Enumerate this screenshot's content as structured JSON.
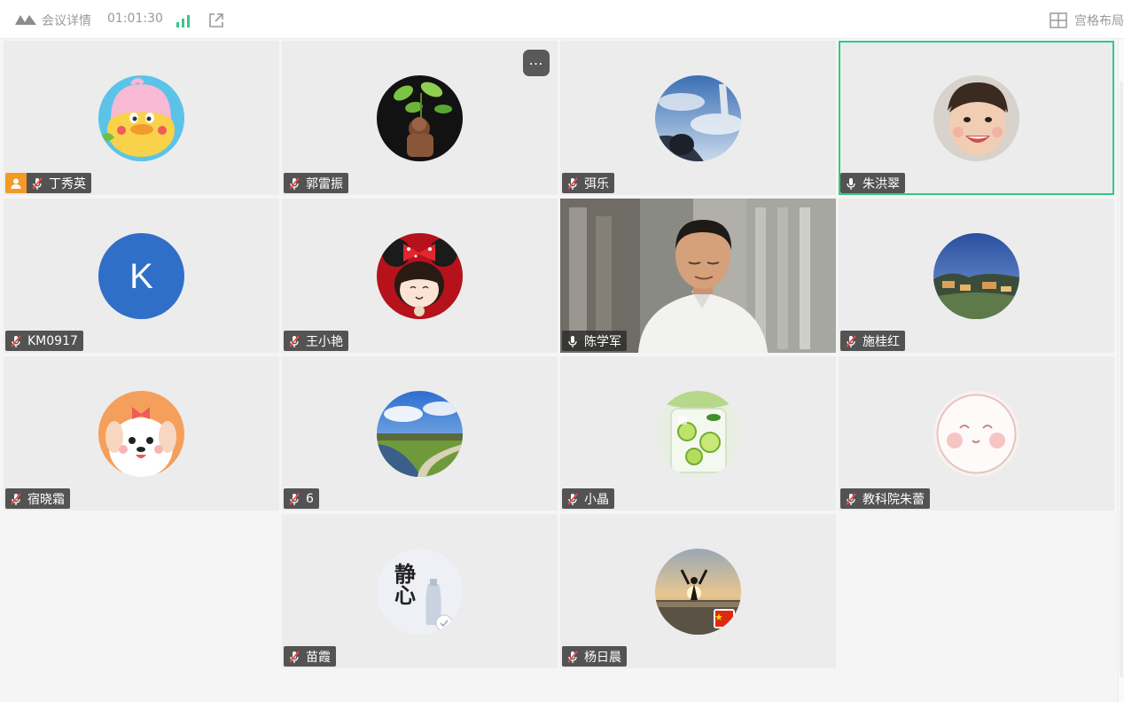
{
  "topbar": {
    "title": "会议详情",
    "elapsed": "01:01:30",
    "layout_label": "宫格布局"
  },
  "participants": [
    {
      "name": "丁秀英",
      "mic": "muted",
      "host": true,
      "avatar": "duck-cartoon-avatar"
    },
    {
      "name": "郭雷振",
      "mic": "muted",
      "avatar": "plant-figurine-avatar",
      "has_more_menu": true
    },
    {
      "name": "弭乐",
      "mic": "muted",
      "avatar": "airplane-window-sky-avatar"
    },
    {
      "name": "朱洪翠",
      "mic": "on",
      "avatar": "toddler-photo-avatar",
      "active_speaker": true
    },
    {
      "name": "KM0917",
      "mic": "muted",
      "avatar_letter": "K",
      "avatar_color": "#2f6fc7"
    },
    {
      "name": "王小艳",
      "mic": "muted",
      "avatar": "cartoon-girl-bow-avatar"
    },
    {
      "name": "陈学军",
      "mic": "on",
      "video": true
    },
    {
      "name": "施桂红",
      "mic": "muted",
      "avatar": "night-town-avatar"
    },
    {
      "name": "宿晓霜",
      "mic": "muted",
      "avatar": "puppy-cartoon-avatar"
    },
    {
      "name": "6",
      "mic": "muted",
      "avatar": "river-landscape-avatar"
    },
    {
      "name": "小晶",
      "mic": "muted",
      "avatar": "lime-drink-avatar"
    },
    {
      "name": "教科院朱蕾",
      "mic": "muted",
      "avatar": "blush-face-avatar"
    },
    {
      "name": "苗霞",
      "mic": "muted",
      "avatar": "calligraphy-vase-avatar",
      "avatar_text": "静心"
    },
    {
      "name": "杨日晨",
      "mic": "muted",
      "avatar": "sunset-silhouette-avatar"
    }
  ],
  "colors": {
    "active_border": "#2fcb86",
    "host_badge": "#f39a27",
    "tile_bg": "#ececec",
    "signal": "#3cc48a"
  }
}
